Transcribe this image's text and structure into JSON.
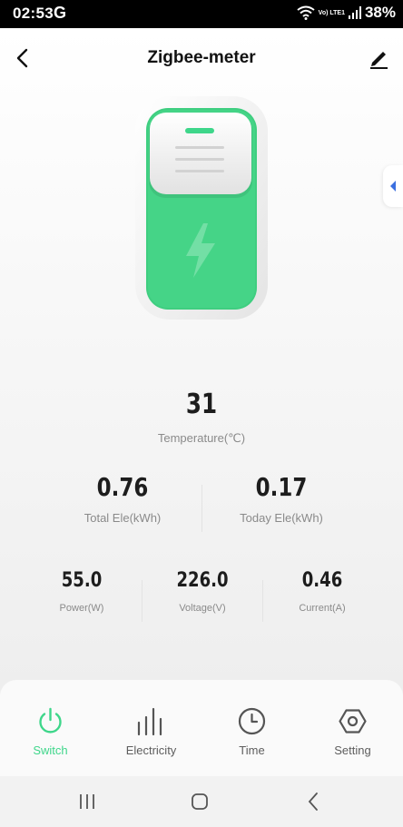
{
  "status_bar": {
    "time": "02:53",
    "google_glyph": "G",
    "battery": "38%",
    "volte": "Vo) LTE1",
    "icons": [
      "wifi-icon",
      "signal-icon"
    ]
  },
  "header": {
    "title": "Zigbee-meter",
    "back_icon": "chevron-left-icon",
    "edit_icon": "pencil-icon"
  },
  "device": {
    "image": "device-illustration",
    "icon": "lightning-icon"
  },
  "metrics": {
    "temperature": {
      "value": "31",
      "label": "Temperature(℃)"
    },
    "total_ele": {
      "value": "0.76",
      "label": "Total Ele(kWh)"
    },
    "today_ele": {
      "value": "0.17",
      "label": "Today Ele(kWh)"
    },
    "power": {
      "value": "55.0",
      "label": "Power(W)"
    },
    "voltage": {
      "value": "226.0",
      "label": "Voltage(V)"
    },
    "current": {
      "value": "0.46",
      "label": "Current(A)"
    }
  },
  "bottom_nav": {
    "items": [
      {
        "label": "Switch",
        "icon": "power-icon",
        "active": true
      },
      {
        "label": "Electricity",
        "icon": "bar-chart-icon",
        "active": false
      },
      {
        "label": "Time",
        "icon": "clock-icon",
        "active": false
      },
      {
        "label": "Setting",
        "icon": "hexagon-settings-icon",
        "active": false
      }
    ]
  },
  "colors": {
    "accent": "#3ed68a",
    "device_green": "#3fce80",
    "text_dark": "#1d1d1d",
    "text_muted": "#8a8a8a",
    "status_bar_bg": "#000000"
  }
}
